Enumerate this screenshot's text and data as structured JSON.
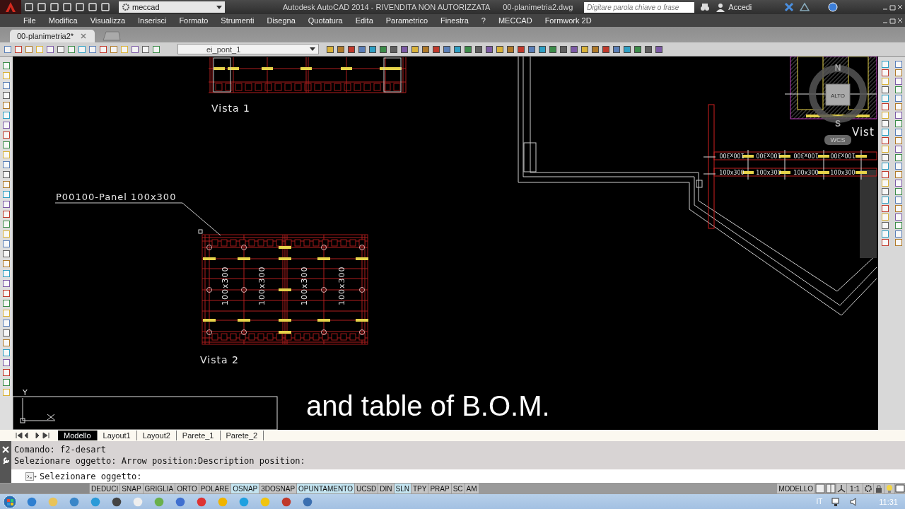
{
  "title_bar": {
    "workspace": "meccad",
    "title": "Autodesk AutoCAD 2014 - RIVENDITA NON AUTORIZZATA",
    "file_name": "00-planimetria2.dwg",
    "search": {
      "placeholder": "Digitare parola chiave o frase"
    },
    "sign_in": "Accedi"
  },
  "menu": [
    "File",
    "Modifica",
    "Visualizza",
    "Inserisci",
    "Formato",
    "Strumenti",
    "Disegna",
    "Quotatura",
    "Edita",
    "Parametrico",
    "Finestra",
    "?",
    "MECCAD",
    "Formwork 2D"
  ],
  "doc_tabs": [
    {
      "label": "00-planimetria2*",
      "selected": true
    }
  ],
  "toolbar": {
    "layer": "ei_pont_1"
  },
  "canvas": {
    "views": [
      {
        "kind": "partial",
        "title": "Vista 1"
      },
      {
        "kind": "full",
        "title": "Vista 2",
        "dimension_labels": [
          "100x300",
          "100x300",
          "100x300",
          "100x300"
        ]
      }
    ],
    "callout": "P00100-Panel 100x300",
    "plan": {
      "rows": [
        {
          "flipped": true,
          "labels": [
            "100x300",
            "100x300",
            "100x300",
            "100x300"
          ]
        },
        {
          "flipped": false,
          "labels": [
            "100x300",
            "100x300",
            "100x300",
            "100x300"
          ]
        }
      ],
      "view_title": "Vist"
    },
    "compass": {
      "north": "N",
      "top": "ALTO",
      "south": "S",
      "ucs": "WCS"
    },
    "ucs_axis": "Y",
    "subtitle": "and table of B.O.M."
  },
  "layout_tabs": [
    {
      "label": "Modello",
      "selected": true
    },
    {
      "label": "Layout1",
      "selected": false
    },
    {
      "label": "Layout2",
      "selected": false
    },
    {
      "label": "Parete_1",
      "selected": false
    },
    {
      "label": "Parete_2",
      "selected": false
    }
  ],
  "command_history": [
    "Comando: f2-desart",
    "Selezionare oggetto: Arrow position:Description position:"
  ],
  "command_prompt": "Selezionare oggetto:",
  "status_toggles": [
    {
      "label": "DEDUCI",
      "on": false
    },
    {
      "label": "SNAP",
      "on": false
    },
    {
      "label": "GRIGLIA",
      "on": false
    },
    {
      "label": "ORTO",
      "on": false
    },
    {
      "label": "POLARE",
      "on": false
    },
    {
      "label": "OSNAP",
      "on": true
    },
    {
      "label": "3DOSNAP",
      "on": false
    },
    {
      "label": "OPUNTAMENTO",
      "on": true
    },
    {
      "label": "UCSD",
      "on": false
    },
    {
      "label": "DIN",
      "on": false
    },
    {
      "label": "SLN",
      "on": true
    },
    {
      "label": "TPY",
      "on": false
    },
    {
      "label": "PRAP",
      "on": false
    },
    {
      "label": "SC",
      "on": false
    },
    {
      "label": "AM",
      "on": false
    }
  ],
  "status_right": {
    "space": "MODELLO",
    "scale": "1:1"
  },
  "taskbar": {
    "language": "IT",
    "time": "11:31"
  }
}
